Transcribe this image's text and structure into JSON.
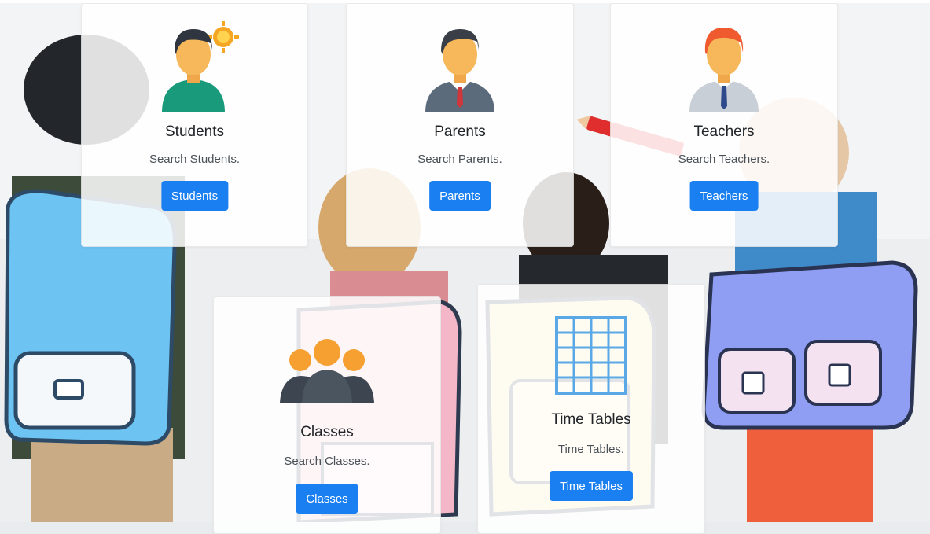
{
  "cards": {
    "students": {
      "title": "Students",
      "text": "Search Students.",
      "button": "Students"
    },
    "parents": {
      "title": "Parents",
      "text": "Search Parents.",
      "button": "Parents"
    },
    "teachers": {
      "title": "Teachers",
      "text": "Search Teachers.",
      "button": "Teachers"
    },
    "classes": {
      "title": "Classes",
      "text": "Search Classes.",
      "button": "Classes"
    },
    "timetables": {
      "title": "Time Tables",
      "text": "Time Tables.",
      "button": "Time Tables"
    }
  },
  "colors": {
    "button": "#1a7ff0",
    "card_background": "#ffffff",
    "title_text": "#212529",
    "body_text": "#495057"
  },
  "icons": {
    "students": "student-avatar-icon",
    "parents": "parent-avatar-icon",
    "teachers": "teacher-avatar-icon",
    "classes": "group-icon",
    "timetables": "calendar-grid-icon"
  }
}
